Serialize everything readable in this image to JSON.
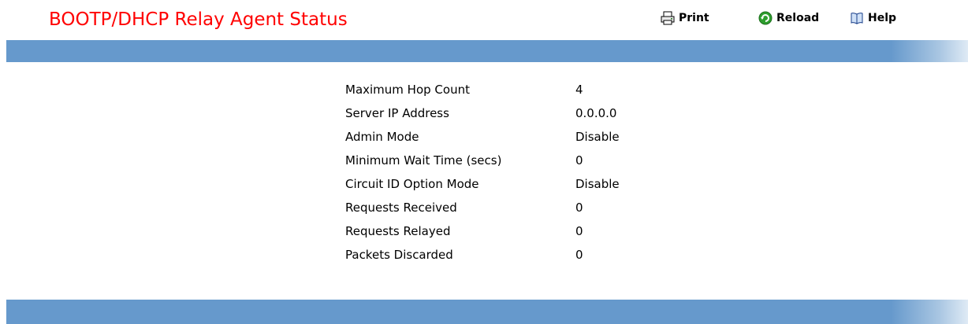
{
  "page": {
    "title": "BOOTP/DHCP Relay Agent Status"
  },
  "toolbar": {
    "print_label": "Print",
    "print_icon": "printer-icon",
    "reload_label": "Reload",
    "reload_icon": "reload-icon",
    "help_label": "Help",
    "help_icon": "book-icon"
  },
  "colors": {
    "title": "#ff0000",
    "band": "#6699cc",
    "reload_icon": "#2e9e2e"
  },
  "status": {
    "rows": [
      {
        "label": "Maximum Hop Count",
        "value": "4"
      },
      {
        "label": "Server IP Address",
        "value": "0.0.0.0"
      },
      {
        "label": "Admin Mode",
        "value": "Disable"
      },
      {
        "label": "Minimum Wait Time (secs)",
        "value": "0"
      },
      {
        "label": "Circuit ID Option Mode",
        "value": "Disable"
      },
      {
        "label": "Requests Received",
        "value": "0"
      },
      {
        "label": "Requests Relayed",
        "value": "0"
      },
      {
        "label": "Packets Discarded",
        "value": "0"
      }
    ]
  }
}
